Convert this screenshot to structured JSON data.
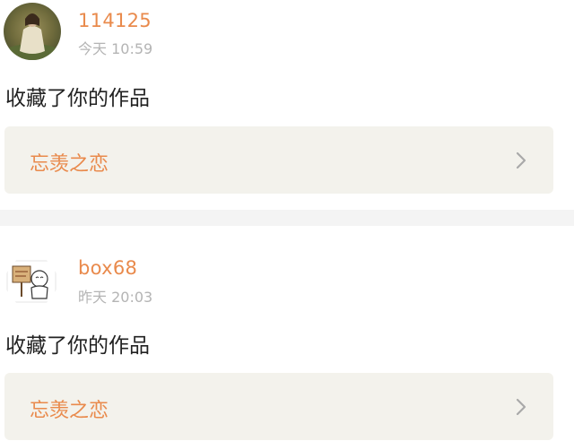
{
  "items": [
    {
      "username": "114125",
      "timestamp": "今天 10:59",
      "action": "收藏了你的作品",
      "work_title": "忘羡之恋",
      "avatar_icon": "avatar-photo-girl-icon",
      "chevron_icon": "chevron-right-icon"
    },
    {
      "username": "box68",
      "timestamp": "昨天 20:03",
      "action": "收藏了你的作品",
      "work_title": "忘羡之恋",
      "avatar_icon": "avatar-cartoon-sign-icon",
      "chevron_icon": "chevron-right-icon"
    }
  ],
  "colors": {
    "accent": "#e98a4c",
    "timestamp": "#b4b4b4",
    "text": "#222222",
    "card_bg": "#f3f2ec",
    "separator": "#f4f4f4"
  }
}
